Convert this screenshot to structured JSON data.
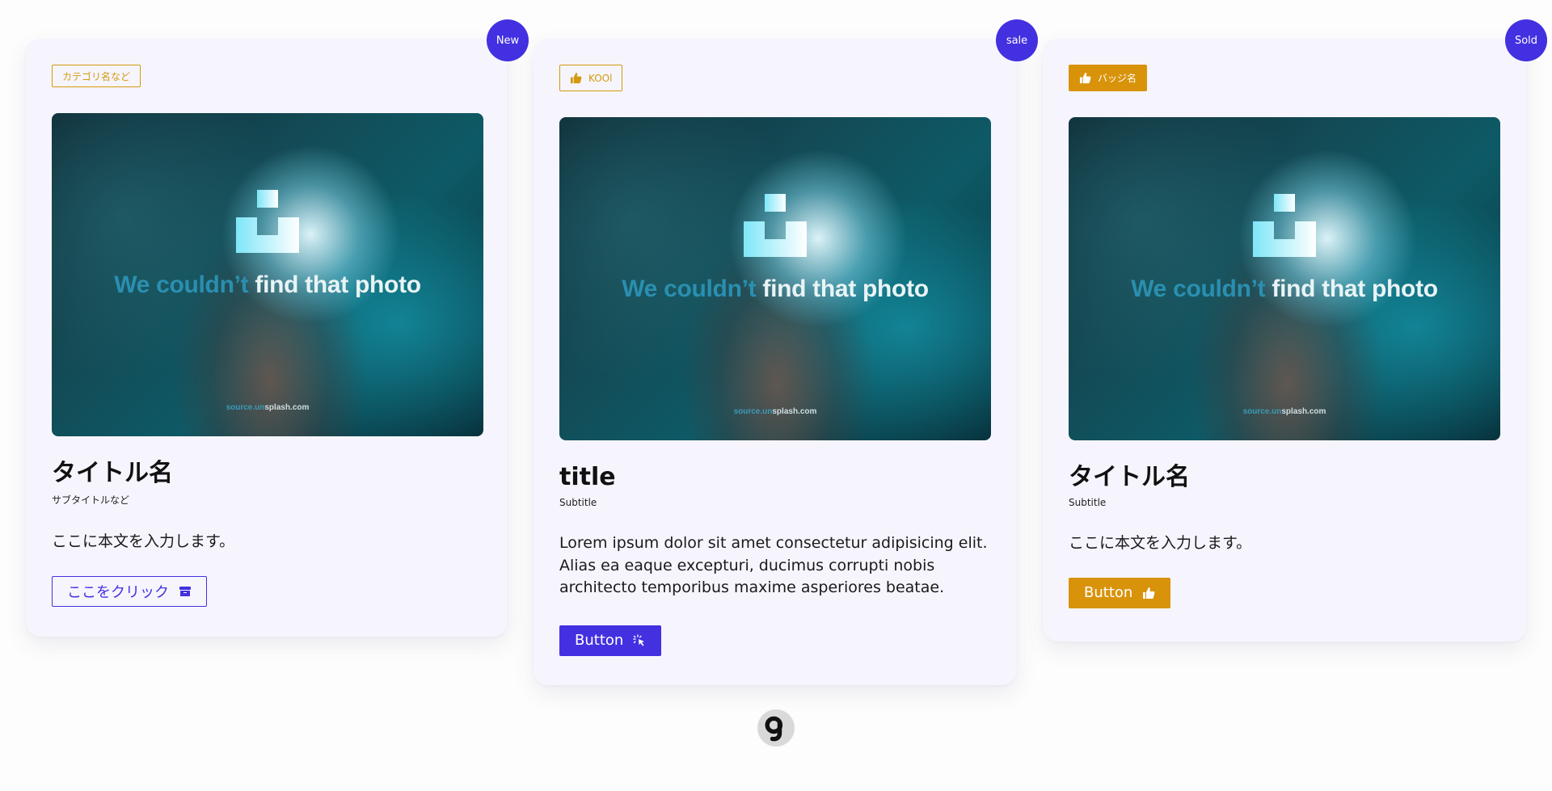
{
  "cards": [
    {
      "badge": "New",
      "tag": "カテゴリ名など",
      "photo": {
        "message_dim": "We couldn’t ",
        "message_bright": "find that photo",
        "source_a": "source.",
        "source_b": "unsplash.com",
        "source_c": "un"
      },
      "title": "タイトル名",
      "subtitle": "サブタイトルなど",
      "body": "ここに本文を入力します。",
      "button": "ここをクリック",
      "button_icon": "archive-icon"
    },
    {
      "badge": "sale",
      "tag": "KOOl",
      "tag_icon": "thumbs-up-icon",
      "photo": {
        "message_dim": "We couldn’t ",
        "message_bright": "find that photo",
        "source_a": "source.",
        "source_b": "unsplash.com",
        "source_c": "un"
      },
      "title": "title",
      "subtitle": "Subtitle",
      "body": "Lorem ipsum dolor sit amet consectetur adipisicing elit. Alias ea eaque excepturi, ducimus corrupti nobis architecto temporibus maxime asperiores beatae.",
      "button": "Button",
      "button_icon": "pointer-click-icon"
    },
    {
      "badge": "Sold",
      "tag": "バッジ名",
      "tag_icon": "thumbs-up-icon",
      "photo": {
        "message_dim": "We couldn’t ",
        "message_bright": "find that photo",
        "source_a": "source.",
        "source_b": "unsplash.com",
        "source_c": "un"
      },
      "title": "タイトル名",
      "subtitle": "Subtitle",
      "body": "ここに本文を入力します。",
      "button": "Button",
      "button_icon": "thumbs-up-icon"
    }
  ],
  "colors": {
    "primary": "#4330e0",
    "amber": "#d8930a",
    "card_bg": "#f6f5fe"
  },
  "footer": {
    "avatar_icon": "gj-logo-icon"
  }
}
